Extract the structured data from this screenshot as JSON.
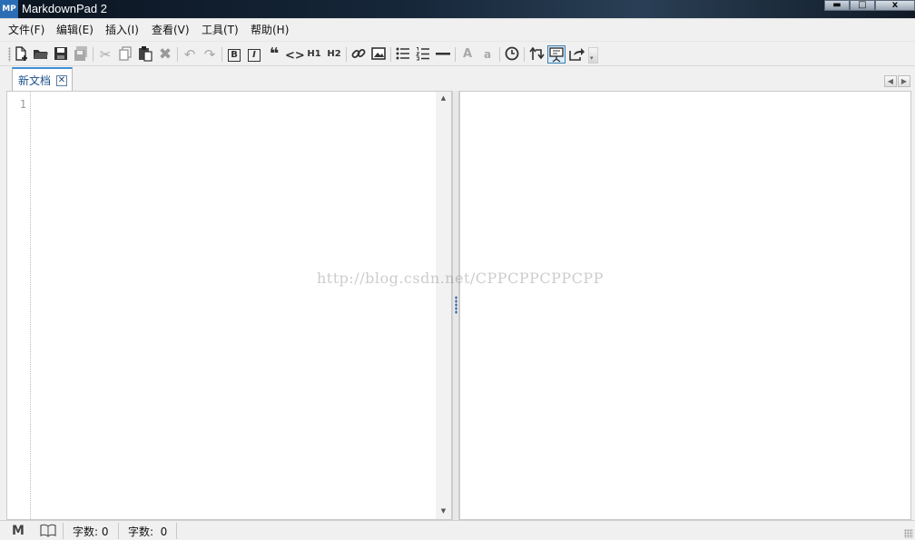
{
  "window": {
    "logo_text": "MP",
    "title": "MarkdownPad 2",
    "buttons": [
      "minimize-icon",
      "maximize-icon",
      "close-icon"
    ]
  },
  "menu": [
    {
      "label": "文件(F)"
    },
    {
      "label": "编辑(E)"
    },
    {
      "label": "插入(I)"
    },
    {
      "label": "查看(V)"
    },
    {
      "label": "工具(T)"
    },
    {
      "label": "帮助(H)"
    }
  ],
  "toolbar": {
    "h1_label": "H1",
    "h2_label": "H2",
    "bold_label": "B",
    "italic_label": "I",
    "upper_label": "A",
    "lower_label": "a",
    "icons": [
      "new-file-icon",
      "open-folder-icon",
      "save-icon",
      "save-all-icon",
      "cut-icon",
      "copy-icon",
      "paste-icon",
      "delete-icon",
      "undo-icon",
      "redo-icon",
      "bold-icon",
      "italic-icon",
      "quote-icon",
      "code-icon",
      "h1-icon",
      "h2-icon",
      "link-icon",
      "image-icon",
      "unordered-list-icon",
      "ordered-list-icon",
      "horizontal-rule-icon",
      "uppercase-icon",
      "lowercase-icon",
      "timestamp-icon",
      "sync-scroll-icon",
      "live-preview-icon",
      "export-icon"
    ]
  },
  "tabs": [
    {
      "label": "新文档",
      "active": true
    }
  ],
  "editor": {
    "line_numbers": [
      "1"
    ]
  },
  "watermark": "http://blog.csdn.net/CPPCPPCPPCPP",
  "status": {
    "word_count_1": "字数: 0",
    "word_count_2": "字数:  0"
  },
  "colors": {
    "accent": "#3c8fd8",
    "logo_bg": "#2a6db5"
  }
}
